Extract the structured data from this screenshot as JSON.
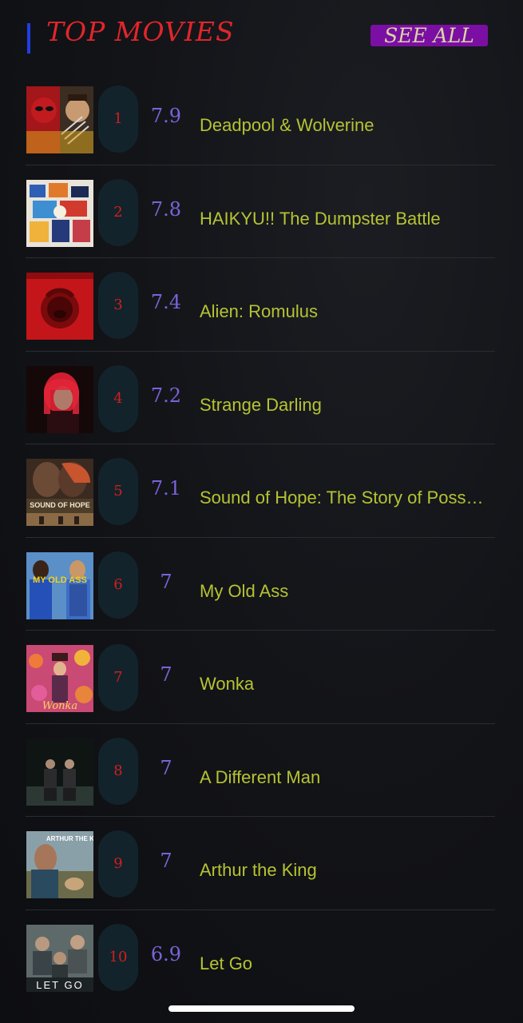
{
  "header": {
    "title": "TOP MOVIES",
    "see_all_label": "SEE ALL",
    "accent_color": "#1f3ee6",
    "title_color": "#e0262b",
    "button_color": "#7b0fa3"
  },
  "movies": [
    {
      "rank": "1",
      "rating": "7.9",
      "title": "Deadpool & Wolverine",
      "poster_icon": "deadpool-wolverine-poster"
    },
    {
      "rank": "2",
      "rating": "7.8",
      "title": "HAIKYU!! The Dumpster Battle",
      "poster_icon": "haikyu-poster"
    },
    {
      "rank": "3",
      "rating": "7.4",
      "title": "Alien: Romulus",
      "poster_icon": "alien-romulus-poster"
    },
    {
      "rank": "4",
      "rating": "7.2",
      "title": "Strange Darling",
      "poster_icon": "strange-darling-poster"
    },
    {
      "rank": "5",
      "rating": "7.1",
      "title": "Sound of Hope: The Story of Possum Trot",
      "poster_icon": "sound-of-hope-poster",
      "poster_text": "SOUND OF HOPE"
    },
    {
      "rank": "6",
      "rating": "7",
      "title": "My Old Ass",
      "poster_icon": "my-old-ass-poster",
      "poster_text": "MY OLD ASS"
    },
    {
      "rank": "7",
      "rating": "7",
      "title": "Wonka",
      "poster_icon": "wonka-poster",
      "poster_text": "Wonka"
    },
    {
      "rank": "8",
      "rating": "7",
      "title": "A Different Man",
      "poster_icon": "a-different-man-poster"
    },
    {
      "rank": "9",
      "rating": "7",
      "title": "Arthur the King",
      "poster_icon": "arthur-the-king-poster",
      "poster_text": "ARTHUR THE KING"
    },
    {
      "rank": "10",
      "rating": "6.9",
      "title": "Let Go",
      "poster_icon": "let-go-poster",
      "poster_text": "LET GO"
    }
  ]
}
